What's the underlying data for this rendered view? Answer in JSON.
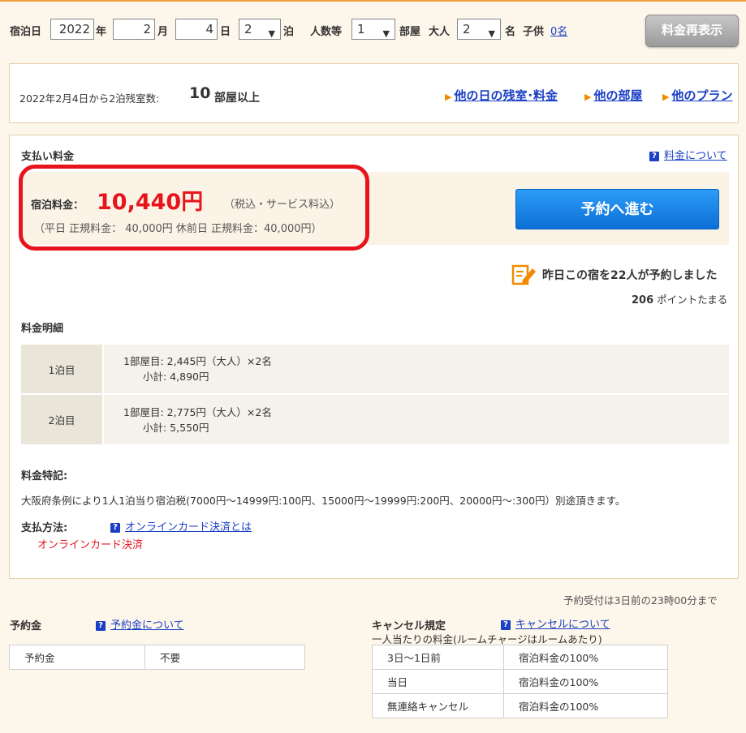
{
  "search": {
    "checkin_label": "宿泊日",
    "year_value": "2022",
    "year_unit": "年",
    "month_value": "2",
    "month_unit": "月",
    "day_value": "4",
    "day_unit": "日",
    "nights_value": "2",
    "nights_unit": "泊",
    "people_label": "人数等",
    "rooms_value": "1",
    "rooms_unit": "部屋",
    "adults_label": "大人",
    "adults_value": "2",
    "adults_unit": "名",
    "children_label": "子供",
    "children_value": "0名",
    "redisplay_label": "料金再表示"
  },
  "availability": {
    "text": "2022年2月4日から2泊残室数:",
    "count": "10",
    "suffix": "部屋以上",
    "links": [
      "他の日の残室･料金",
      "他の部屋",
      "他のプラン"
    ]
  },
  "payment": {
    "title": "支払い料金",
    "about_price": "料金について",
    "price_label": "宿泊料金：",
    "price_value": "10,440円",
    "tax_note": "（税込・サービス料込）",
    "regular_note": "（平日 正規料金： 40,000円 休前日 正規料金：40,000円）",
    "book_button": "予約へ進む",
    "booked_text": "昨日この宿を22人が予約しました",
    "points_value": "206",
    "points_suffix": "ポイントたまる"
  },
  "breakdown": {
    "title": "料金明細",
    "rows": [
      {
        "night": "1泊目",
        "line1": "1部屋目: 2,445円（大人）×2名",
        "line2": "小計: 4,890円"
      },
      {
        "night": "2泊目",
        "line1": "1部屋目: 2,775円（大人）×2名",
        "line2": "小計: 5,550円"
      }
    ]
  },
  "notes": {
    "title": "料金特記:",
    "text": "大阪府条例により1人1泊当り宿泊税(7000円～14999円:100円、15000円～19999円:200円、20000円～:300円）別途頂きます。",
    "method_title": "支払方法:",
    "method_link": "オンラインカード決済とは",
    "method_value": "オンラインカード決済"
  },
  "deadline": "予約受付は3日前の23時00分まで",
  "deposit": {
    "title": "予約金",
    "link": "予約金について",
    "label": "予約金",
    "value": "不要"
  },
  "cancel": {
    "title": "キャンセル規定",
    "link": "キャンセルについて",
    "note": "一人当たりの料金(ルームチャージはルームあたり)",
    "rows": [
      {
        "when": "3日～1日前",
        "fee": "宿泊料金の100%"
      },
      {
        "when": "当日",
        "fee": "宿泊料金の100%"
      },
      {
        "when": "無連絡キャンセル",
        "fee": "宿泊料金の100%"
      }
    ]
  },
  "colors": {
    "price_red": "#e8141c",
    "link_blue": "#1a3fc4",
    "book_blue": "#1a7fe6",
    "background": "#fdf6ea"
  }
}
